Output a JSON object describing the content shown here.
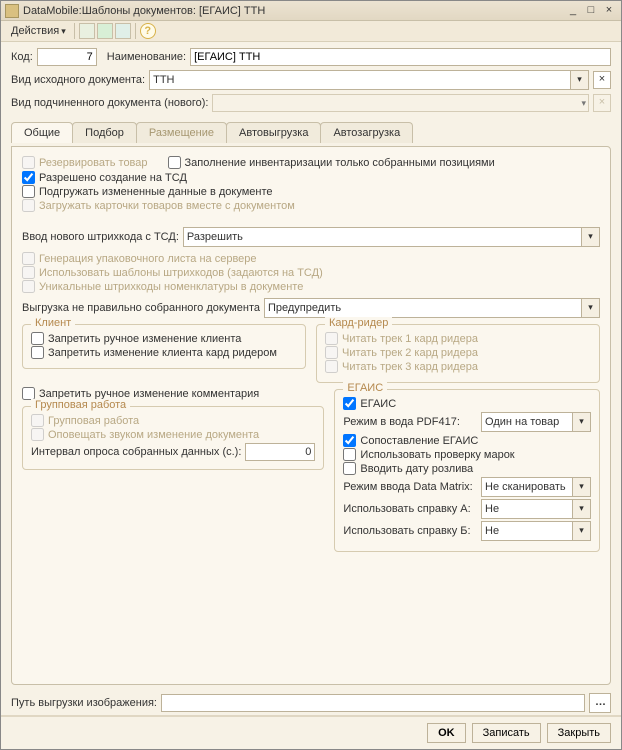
{
  "window": {
    "title": "DataMobile:Шаблоны документов: [ЕГАИС] ТТН",
    "min": "_",
    "max": "□",
    "close": "×"
  },
  "toolbar": {
    "actions": "Действия"
  },
  "header": {
    "code_label": "Код:",
    "code_value": "7",
    "name_label": "Наименование:",
    "name_value": "[ЕГАИС] ТТН",
    "src_doc_label": "Вид исходного документа:",
    "src_doc_value": "ТТН",
    "sub_doc_label": "Вид подчиненного документа (нового):"
  },
  "tabs": {
    "t0": "Общие",
    "t1": "Подбор",
    "t2": "Размещение",
    "t3": "Автовыгрузка",
    "t4": "Автозагрузка"
  },
  "general": {
    "reserve": "Резервировать товар",
    "inv_fill": "Заполнение инвентаризации только собранными позициями",
    "allow_create": "Разрешено создание на ТСД",
    "load_changed": "Подгружать измененные данные в документе",
    "load_cards": "Загружать карточки товаров вместе с документом",
    "new_bc_label": "Ввод нового штрихкода с ТСД:",
    "new_bc_value": "Разрешить",
    "gen_pack": "Генерация упаковочного листа на сервере",
    "use_templates": "Использовать шаблоны штрихкодов (задаются на ТСД)",
    "unique_bc": "Уникальные штрихкоды номенклатуры в документе",
    "wrong_doc_label": "Выгрузка не правильно собранного документа",
    "wrong_doc_value": "Предупредить"
  },
  "client": {
    "legend": "Клиент",
    "forbid_manual": "Запретить ручное изменение клиента",
    "forbid_card": "Запретить изменение клиента кард ридером"
  },
  "cardreader": {
    "legend": "Кард-ридер",
    "track1": "Читать трек 1 кард ридера",
    "track2": "Читать трек 2 кард ридера",
    "track3": "Читать трек 3 кард ридера"
  },
  "forbid_comment": "Запретить ручное изменение комментария",
  "groupwork": {
    "legend": "Групповая работа",
    "gw": "Групповая работа",
    "sound": "Оповещать звуком изменение документа",
    "interval_label": "Интервал опроса собранных данных (с.):",
    "interval_value": "0"
  },
  "egais": {
    "legend": "ЕГАИС",
    "enabled": "ЕГАИС",
    "mode_label": "Режим в вода PDF417:",
    "mode_value": "Один на товар",
    "match": "Сопоставление ЕГАИС",
    "check_marks": "Использовать проверку марок",
    "bottling_date": "Вводить дату розлива",
    "dm_label": "Режим ввода Data Matrix:",
    "dm_value": "Не сканировать",
    "refa_label": "Использовать справку А:",
    "refa_value": "Не использовать",
    "refb_label": "Использовать справку Б:",
    "refb_value": "Не использовать"
  },
  "bottom": {
    "img_path_label": "Путь выгрузки изображения:"
  },
  "footer": {
    "ok": "OK",
    "save": "Записать",
    "close": "Закрыть"
  }
}
